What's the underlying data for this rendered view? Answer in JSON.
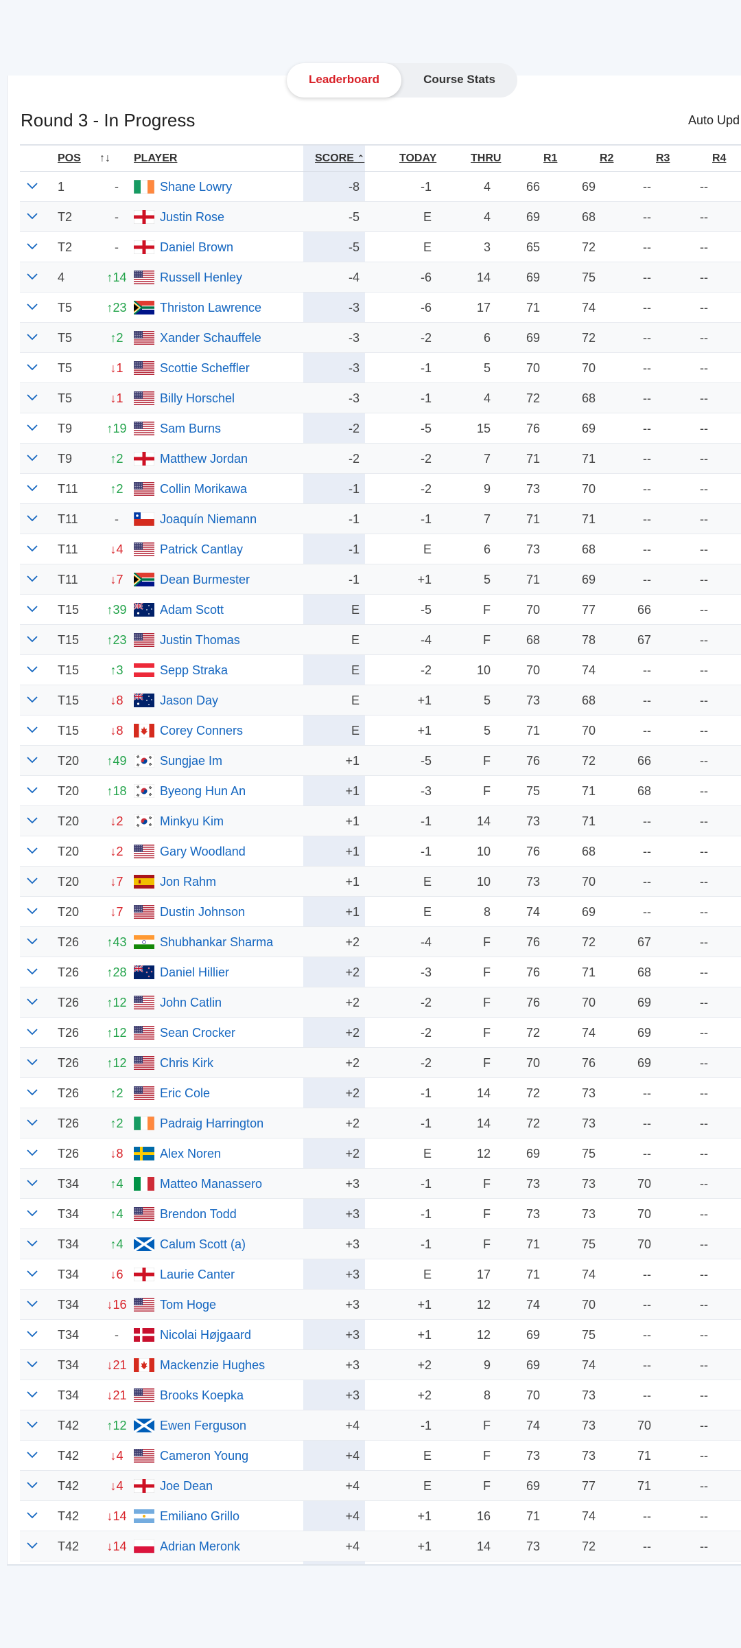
{
  "tabs": {
    "leaderboard": "Leaderboard",
    "course_stats": "Course Stats"
  },
  "round_title": "Round 3 - In Progress",
  "auto_update": "Auto Upd",
  "columns": {
    "pos": "POS",
    "move": "↑↓",
    "player": "PLAYER",
    "score": "SCORE",
    "sort_icon": "⌃",
    "today": "TODAY",
    "thru": "THRU",
    "r1": "R1",
    "r2": "R2",
    "r3": "R3",
    "r4": "R4"
  },
  "colors": {
    "accent": "#d81f26",
    "link": "#1466c0",
    "up": "#22a34a",
    "down": "#d8232a",
    "score_col": "#e8edf6"
  },
  "rows": [
    {
      "pos": "1",
      "move": "-",
      "dir": "none",
      "flag": "ireland",
      "player": "Shane Lowry",
      "score": "-8",
      "today": "-1",
      "thru": "4",
      "r1": "66",
      "r2": "69",
      "r3": "--",
      "r4": "--"
    },
    {
      "pos": "T2",
      "move": "-",
      "dir": "none",
      "flag": "england",
      "player": "Justin Rose",
      "score": "-5",
      "today": "E",
      "thru": "4",
      "r1": "69",
      "r2": "68",
      "r3": "--",
      "r4": "--"
    },
    {
      "pos": "T2",
      "move": "-",
      "dir": "none",
      "flag": "england",
      "player": "Daniel Brown",
      "score": "-5",
      "today": "E",
      "thru": "3",
      "r1": "65",
      "r2": "72",
      "r3": "--",
      "r4": "--"
    },
    {
      "pos": "4",
      "move": "14",
      "dir": "up",
      "flag": "usa",
      "player": "Russell Henley",
      "score": "-4",
      "today": "-6",
      "thru": "14",
      "r1": "69",
      "r2": "75",
      "r3": "--",
      "r4": "--"
    },
    {
      "pos": "T5",
      "move": "23",
      "dir": "up",
      "flag": "south-africa",
      "player": "Thriston Lawrence",
      "score": "-3",
      "today": "-6",
      "thru": "17",
      "r1": "71",
      "r2": "74",
      "r3": "--",
      "r4": "--"
    },
    {
      "pos": "T5",
      "move": "2",
      "dir": "up",
      "flag": "usa",
      "player": "Xander Schauffele",
      "score": "-3",
      "today": "-2",
      "thru": "6",
      "r1": "69",
      "r2": "72",
      "r3": "--",
      "r4": "--"
    },
    {
      "pos": "T5",
      "move": "1",
      "dir": "down",
      "flag": "usa",
      "player": "Scottie Scheffler",
      "score": "-3",
      "today": "-1",
      "thru": "5",
      "r1": "70",
      "r2": "70",
      "r3": "--",
      "r4": "--"
    },
    {
      "pos": "T5",
      "move": "1",
      "dir": "down",
      "flag": "usa",
      "player": "Billy Horschel",
      "score": "-3",
      "today": "-1",
      "thru": "4",
      "r1": "72",
      "r2": "68",
      "r3": "--",
      "r4": "--"
    },
    {
      "pos": "T9",
      "move": "19",
      "dir": "up",
      "flag": "usa",
      "player": "Sam Burns",
      "score": "-2",
      "today": "-5",
      "thru": "15",
      "r1": "76",
      "r2": "69",
      "r3": "--",
      "r4": "--"
    },
    {
      "pos": "T9",
      "move": "2",
      "dir": "up",
      "flag": "england",
      "player": "Matthew Jordan",
      "score": "-2",
      "today": "-2",
      "thru": "7",
      "r1": "71",
      "r2": "71",
      "r3": "--",
      "r4": "--"
    },
    {
      "pos": "T11",
      "move": "2",
      "dir": "up",
      "flag": "usa",
      "player": "Collin Morikawa",
      "score": "-1",
      "today": "-2",
      "thru": "9",
      "r1": "73",
      "r2": "70",
      "r3": "--",
      "r4": "--"
    },
    {
      "pos": "T11",
      "move": "-",
      "dir": "none",
      "flag": "chile",
      "player": "Joaquín Niemann",
      "score": "-1",
      "today": "-1",
      "thru": "7",
      "r1": "71",
      "r2": "71",
      "r3": "--",
      "r4": "--"
    },
    {
      "pos": "T11",
      "move": "4",
      "dir": "down",
      "flag": "usa",
      "player": "Patrick Cantlay",
      "score": "-1",
      "today": "E",
      "thru": "6",
      "r1": "73",
      "r2": "68",
      "r3": "--",
      "r4": "--"
    },
    {
      "pos": "T11",
      "move": "7",
      "dir": "down",
      "flag": "south-africa",
      "player": "Dean Burmester",
      "score": "-1",
      "today": "+1",
      "thru": "5",
      "r1": "71",
      "r2": "69",
      "r3": "--",
      "r4": "--"
    },
    {
      "pos": "T15",
      "move": "39",
      "dir": "up",
      "flag": "australia",
      "player": "Adam Scott",
      "score": "E",
      "today": "-5",
      "thru": "F",
      "r1": "70",
      "r2": "77",
      "r3": "66",
      "r4": "--"
    },
    {
      "pos": "T15",
      "move": "23",
      "dir": "up",
      "flag": "usa",
      "player": "Justin Thomas",
      "score": "E",
      "today": "-4",
      "thru": "F",
      "r1": "68",
      "r2": "78",
      "r3": "67",
      "r4": "--"
    },
    {
      "pos": "T15",
      "move": "3",
      "dir": "up",
      "flag": "austria",
      "player": "Sepp Straka",
      "score": "E",
      "today": "-2",
      "thru": "10",
      "r1": "70",
      "r2": "74",
      "r3": "--",
      "r4": "--"
    },
    {
      "pos": "T15",
      "move": "8",
      "dir": "down",
      "flag": "australia",
      "player": "Jason Day",
      "score": "E",
      "today": "+1",
      "thru": "5",
      "r1": "73",
      "r2": "68",
      "r3": "--",
      "r4": "--"
    },
    {
      "pos": "T15",
      "move": "8",
      "dir": "down",
      "flag": "canada",
      "player": "Corey Conners",
      "score": "E",
      "today": "+1",
      "thru": "5",
      "r1": "71",
      "r2": "70",
      "r3": "--",
      "r4": "--"
    },
    {
      "pos": "T20",
      "move": "49",
      "dir": "up",
      "flag": "korea",
      "player": "Sungjae Im",
      "score": "+1",
      "today": "-5",
      "thru": "F",
      "r1": "76",
      "r2": "72",
      "r3": "66",
      "r4": "--"
    },
    {
      "pos": "T20",
      "move": "18",
      "dir": "up",
      "flag": "korea",
      "player": "Byeong Hun An",
      "score": "+1",
      "today": "-3",
      "thru": "F",
      "r1": "75",
      "r2": "71",
      "r3": "68",
      "r4": "--"
    },
    {
      "pos": "T20",
      "move": "2",
      "dir": "down",
      "flag": "korea",
      "player": "Minkyu Kim",
      "score": "+1",
      "today": "-1",
      "thru": "14",
      "r1": "73",
      "r2": "71",
      "r3": "--",
      "r4": "--"
    },
    {
      "pos": "T20",
      "move": "2",
      "dir": "down",
      "flag": "usa",
      "player": "Gary Woodland",
      "score": "+1",
      "today": "-1",
      "thru": "10",
      "r1": "76",
      "r2": "68",
      "r3": "--",
      "r4": "--"
    },
    {
      "pos": "T20",
      "move": "7",
      "dir": "down",
      "flag": "spain",
      "player": "Jon Rahm",
      "score": "+1",
      "today": "E",
      "thru": "10",
      "r1": "73",
      "r2": "70",
      "r3": "--",
      "r4": "--"
    },
    {
      "pos": "T20",
      "move": "7",
      "dir": "down",
      "flag": "usa",
      "player": "Dustin Johnson",
      "score": "+1",
      "today": "E",
      "thru": "8",
      "r1": "74",
      "r2": "69",
      "r3": "--",
      "r4": "--"
    },
    {
      "pos": "T26",
      "move": "43",
      "dir": "up",
      "flag": "india",
      "player": "Shubhankar Sharma",
      "score": "+2",
      "today": "-4",
      "thru": "F",
      "r1": "76",
      "r2": "72",
      "r3": "67",
      "r4": "--"
    },
    {
      "pos": "T26",
      "move": "28",
      "dir": "up",
      "flag": "new-zealand",
      "player": "Daniel Hillier",
      "score": "+2",
      "today": "-3",
      "thru": "F",
      "r1": "76",
      "r2": "71",
      "r3": "68",
      "r4": "--"
    },
    {
      "pos": "T26",
      "move": "12",
      "dir": "up",
      "flag": "usa",
      "player": "John Catlin",
      "score": "+2",
      "today": "-2",
      "thru": "F",
      "r1": "76",
      "r2": "70",
      "r3": "69",
      "r4": "--"
    },
    {
      "pos": "T26",
      "move": "12",
      "dir": "up",
      "flag": "usa",
      "player": "Sean Crocker",
      "score": "+2",
      "today": "-2",
      "thru": "F",
      "r1": "72",
      "r2": "74",
      "r3": "69",
      "r4": "--"
    },
    {
      "pos": "T26",
      "move": "12",
      "dir": "up",
      "flag": "usa",
      "player": "Chris Kirk",
      "score": "+2",
      "today": "-2",
      "thru": "F",
      "r1": "70",
      "r2": "76",
      "r3": "69",
      "r4": "--"
    },
    {
      "pos": "T26",
      "move": "2",
      "dir": "up",
      "flag": "usa",
      "player": "Eric Cole",
      "score": "+2",
      "today": "-1",
      "thru": "14",
      "r1": "72",
      "r2": "73",
      "r3": "--",
      "r4": "--"
    },
    {
      "pos": "T26",
      "move": "2",
      "dir": "up",
      "flag": "ireland",
      "player": "Padraig Harrington",
      "score": "+2",
      "today": "-1",
      "thru": "14",
      "r1": "72",
      "r2": "73",
      "r3": "--",
      "r4": "--"
    },
    {
      "pos": "T26",
      "move": "8",
      "dir": "down",
      "flag": "sweden",
      "player": "Alex Noren",
      "score": "+2",
      "today": "E",
      "thru": "12",
      "r1": "69",
      "r2": "75",
      "r3": "--",
      "r4": "--"
    },
    {
      "pos": "T34",
      "move": "4",
      "dir": "up",
      "flag": "italy",
      "player": "Matteo Manassero",
      "score": "+3",
      "today": "-1",
      "thru": "F",
      "r1": "73",
      "r2": "73",
      "r3": "70",
      "r4": "--"
    },
    {
      "pos": "T34",
      "move": "4",
      "dir": "up",
      "flag": "usa",
      "player": "Brendon Todd",
      "score": "+3",
      "today": "-1",
      "thru": "F",
      "r1": "73",
      "r2": "73",
      "r3": "70",
      "r4": "--"
    },
    {
      "pos": "T34",
      "move": "4",
      "dir": "up",
      "flag": "scotland",
      "player": "Calum Scott (a)",
      "score": "+3",
      "today": "-1",
      "thru": "F",
      "r1": "71",
      "r2": "75",
      "r3": "70",
      "r4": "--"
    },
    {
      "pos": "T34",
      "move": "6",
      "dir": "down",
      "flag": "england",
      "player": "Laurie Canter",
      "score": "+3",
      "today": "E",
      "thru": "17",
      "r1": "71",
      "r2": "74",
      "r3": "--",
      "r4": "--"
    },
    {
      "pos": "T34",
      "move": "16",
      "dir": "down",
      "flag": "usa",
      "player": "Tom Hoge",
      "score": "+3",
      "today": "+1",
      "thru": "12",
      "r1": "74",
      "r2": "70",
      "r3": "--",
      "r4": "--"
    },
    {
      "pos": "T34",
      "move": "-",
      "dir": "none",
      "flag": "denmark",
      "player": "Nicolai Højgaard",
      "score": "+3",
      "today": "+1",
      "thru": "12",
      "r1": "69",
      "r2": "75",
      "r3": "--",
      "r4": "--"
    },
    {
      "pos": "T34",
      "move": "21",
      "dir": "down",
      "flag": "canada",
      "player": "Mackenzie Hughes",
      "score": "+3",
      "today": "+2",
      "thru": "9",
      "r1": "69",
      "r2": "74",
      "r3": "--",
      "r4": "--"
    },
    {
      "pos": "T34",
      "move": "21",
      "dir": "down",
      "flag": "usa",
      "player": "Brooks Koepka",
      "score": "+3",
      "today": "+2",
      "thru": "8",
      "r1": "70",
      "r2": "73",
      "r3": "--",
      "r4": "--"
    },
    {
      "pos": "T42",
      "move": "12",
      "dir": "up",
      "flag": "scotland",
      "player": "Ewen Ferguson",
      "score": "+4",
      "today": "-1",
      "thru": "F",
      "r1": "74",
      "r2": "73",
      "r3": "70",
      "r4": "--"
    },
    {
      "pos": "T42",
      "move": "4",
      "dir": "down",
      "flag": "usa",
      "player": "Cameron Young",
      "score": "+4",
      "today": "E",
      "thru": "F",
      "r1": "73",
      "r2": "73",
      "r3": "71",
      "r4": "--"
    },
    {
      "pos": "T42",
      "move": "4",
      "dir": "down",
      "flag": "england",
      "player": "Joe Dean",
      "score": "+4",
      "today": "E",
      "thru": "F",
      "r1": "69",
      "r2": "77",
      "r3": "71",
      "r4": "--"
    },
    {
      "pos": "T42",
      "move": "14",
      "dir": "down",
      "flag": "argentina",
      "player": "Emiliano Grillo",
      "score": "+4",
      "today": "+1",
      "thru": "16",
      "r1": "71",
      "r2": "74",
      "r3": "--",
      "r4": "--"
    },
    {
      "pos": "T42",
      "move": "14",
      "dir": "down",
      "flag": "poland",
      "player": "Adrian Meronk",
      "score": "+4",
      "today": "+1",
      "thru": "14",
      "r1": "73",
      "r2": "72",
      "r3": "--",
      "r4": "--"
    }
  ]
}
